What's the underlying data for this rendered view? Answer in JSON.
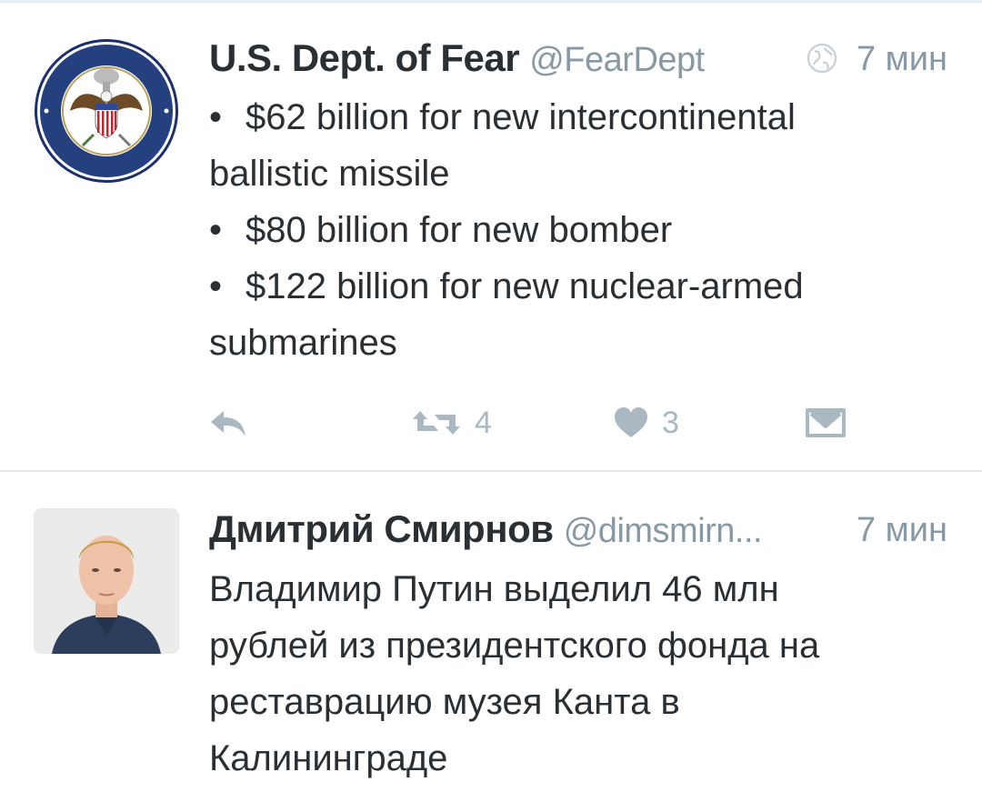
{
  "tweets": [
    {
      "name": "U.S. Dept. of Fear",
      "handle": "@FearDept",
      "time": "7 мин",
      "avatar_icon": "department-of-fear-seal",
      "bullets": [
        {
          "marker": "•",
          "line1": "$62 billion for new intercontinental",
          "line2": "ballistic missile"
        },
        {
          "marker": "•",
          "line1": "$80 billion for new bomber",
          "line2": ""
        },
        {
          "marker": "•",
          "line1": "$122 billion for new nuclear-armed",
          "line2": "submarines"
        }
      ],
      "actions": {
        "reply_icon": "reply-icon",
        "retweet_icon": "retweet-icon",
        "retweet_count": "4",
        "like_icon": "heart-icon",
        "like_count": "3",
        "dm_icon": "envelope-icon"
      }
    },
    {
      "name": "Дмитрий Смирнов",
      "handle": "@dimsmirn...",
      "time": "7 мин",
      "avatar_icon": "user-photo",
      "lines": [
        "Владимир Путин выделил 46 млн",
        "рублей из президентского фонда на",
        "реставрацию музея Канта в",
        "Калининграде"
      ]
    }
  ],
  "colors": {
    "text": "#292f33",
    "muted": "#8899a6",
    "icon": "#aab8c2",
    "divider": "#e1e8ed"
  }
}
